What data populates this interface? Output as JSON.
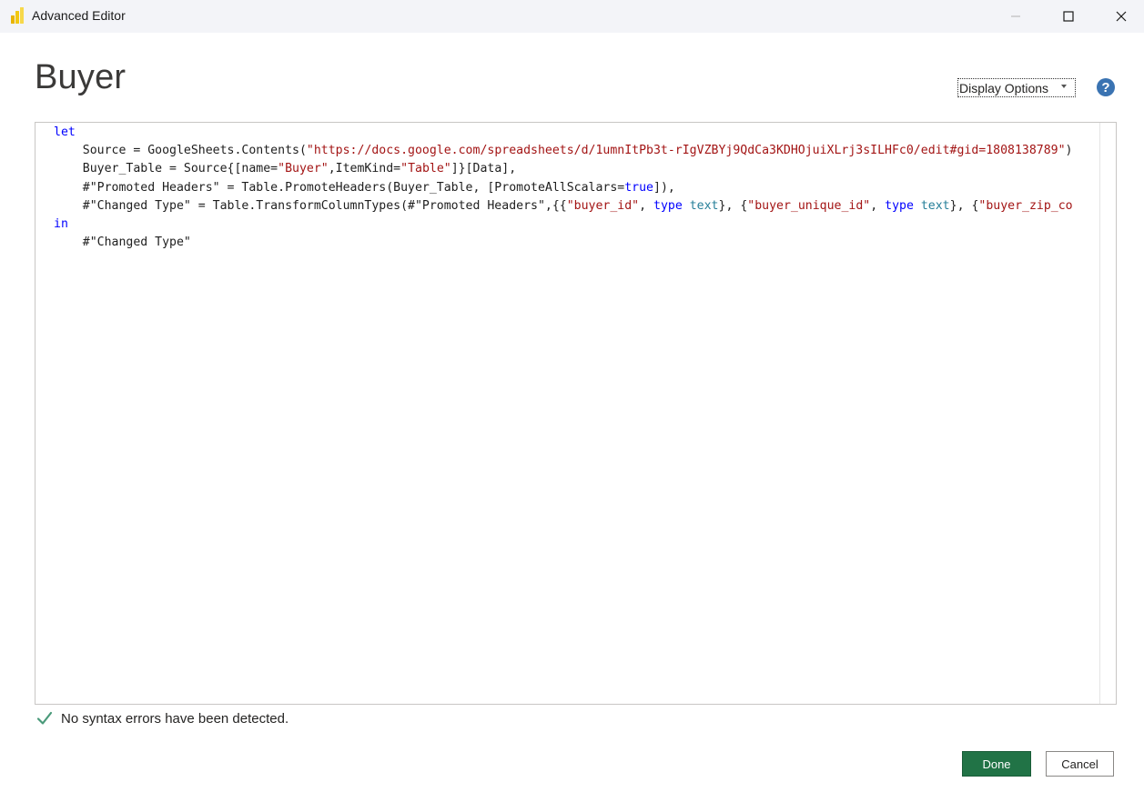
{
  "window": {
    "title": "Advanced Editor",
    "icons": {
      "app": "powerbi-icon",
      "minimize": "minimize-icon",
      "maximize": "maximize-icon",
      "close": "close-icon"
    }
  },
  "header": {
    "title": "Buyer",
    "display_options_label": "Display Options",
    "help_label": "?"
  },
  "editor": {
    "colors": {
      "keyword": "#0000ff",
      "string": "#a31515",
      "type": "#267f99",
      "text": "#1e1e1e"
    },
    "lines": [
      [
        {
          "t": "let",
          "c": "kw"
        }
      ],
      [
        {
          "t": "    Source = GoogleSheets.Contents("
        },
        {
          "t": "\"https://docs.google.com/spreadsheets/d/1umnItPb3t-rIgVZBYj9QdCa3KDHOjuiXLrj3sILHFc0/edit#gid=1808138789\"",
          "c": "str"
        },
        {
          "t": ")"
        }
      ],
      [
        {
          "t": "    Buyer_Table = Source{[name="
        },
        {
          "t": "\"Buyer\"",
          "c": "str"
        },
        {
          "t": ",ItemKind="
        },
        {
          "t": "\"Table\"",
          "c": "str"
        },
        {
          "t": "]}[Data],"
        }
      ],
      [
        {
          "t": "    #\"Promoted Headers\" = Table.PromoteHeaders(Buyer_Table, [PromoteAllScalars="
        },
        {
          "t": "true",
          "c": "kw"
        },
        {
          "t": "]),"
        }
      ],
      [
        {
          "t": "    #\"Changed Type\" = Table.TransformColumnTypes(#\"Promoted Headers\",{{"
        },
        {
          "t": "\"buyer_id\"",
          "c": "str"
        },
        {
          "t": ", "
        },
        {
          "t": "type",
          "c": "kw"
        },
        {
          "t": " "
        },
        {
          "t": "text",
          "c": "typ"
        },
        {
          "t": "}, {"
        },
        {
          "t": "\"buyer_unique_id\"",
          "c": "str"
        },
        {
          "t": ", "
        },
        {
          "t": "type",
          "c": "kw"
        },
        {
          "t": " "
        },
        {
          "t": "text",
          "c": "typ"
        },
        {
          "t": "}, {"
        },
        {
          "t": "\"buyer_zip_co",
          "c": "str"
        }
      ],
      [
        {
          "t": "in",
          "c": "kw"
        }
      ],
      [
        {
          "t": "    #\"Changed Type\""
        }
      ]
    ]
  },
  "status": {
    "text": "No syntax errors have been detected.",
    "icon": "check-icon",
    "color": "#4a9a7a"
  },
  "footer": {
    "done_label": "Done",
    "cancel_label": "Cancel",
    "accent": "#217346"
  }
}
